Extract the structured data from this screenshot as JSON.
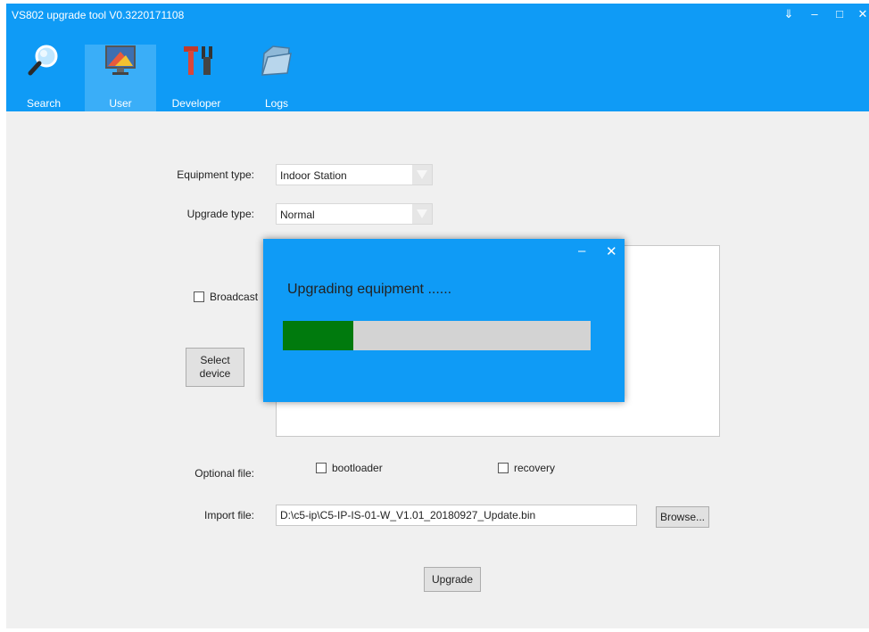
{
  "window": {
    "title": "VS802 upgrade tool V0.3220171108",
    "controls": {
      "menu": "⇓",
      "minimize": "–",
      "maximize": "□",
      "close": "✕"
    }
  },
  "nav": [
    {
      "label": "Search",
      "icon": "magnifier-icon"
    },
    {
      "label": "User",
      "icon": "monitor-icon",
      "active": true
    },
    {
      "label": "Developer",
      "icon": "tools-icon"
    },
    {
      "label": "Logs",
      "icon": "folder-icon"
    }
  ],
  "form": {
    "equipment_type_label": "Equipment type:",
    "equipment_type_value": "Indoor Station",
    "upgrade_type_label": "Upgrade type:",
    "upgrade_type_value": "Normal",
    "broadcast_label": "Broadcast",
    "select_device_label": "Select device",
    "optional_file_label": "Optional file:",
    "bootloader_label": "bootloader",
    "recovery_label": "recovery",
    "import_file_label": "Import file:",
    "import_file_value": "D:\\c5-ip\\C5-IP-IS-01-W_V1.01_20180927_Update.bin",
    "browse_label": "Browse...",
    "upgrade_label": "Upgrade"
  },
  "dialog": {
    "message": "Upgrading equipment ......",
    "minimize": "–",
    "close": "✕",
    "progress": 0.23
  },
  "colors": {
    "accent": "#0f9bf6",
    "progress_fill": "#007a0d",
    "progress_track": "#d3d3d3"
  }
}
